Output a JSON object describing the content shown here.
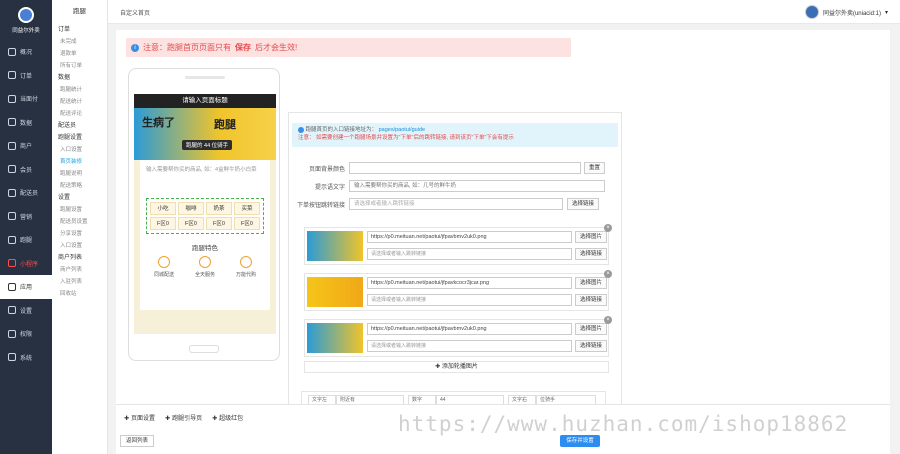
{
  "app": {
    "name": "同益尔外卖"
  },
  "sidebar": {
    "items": [
      {
        "label": "概况",
        "icon": "dashboard-icon",
        "state": ""
      },
      {
        "label": "订单",
        "icon": "order-icon",
        "state": ""
      },
      {
        "label": "当面付",
        "icon": "pay-icon",
        "state": ""
      },
      {
        "label": "数据",
        "icon": "data-icon",
        "state": ""
      },
      {
        "label": "商户",
        "icon": "store-icon",
        "state": ""
      },
      {
        "label": "会员",
        "icon": "member-icon",
        "state": ""
      },
      {
        "label": "配送员",
        "icon": "rider-icon",
        "state": ""
      },
      {
        "label": "营销",
        "icon": "marketing-icon",
        "state": ""
      },
      {
        "label": "跑腿",
        "icon": "errand-icon",
        "state": ""
      },
      {
        "label": "小程序",
        "icon": "miniapp-icon",
        "state": "red"
      },
      {
        "label": "应用",
        "icon": "apps-icon",
        "state": "active"
      },
      {
        "label": "设置",
        "icon": "settings-icon",
        "state": ""
      },
      {
        "label": "权限",
        "icon": "permission-icon",
        "state": ""
      },
      {
        "label": "系统",
        "icon": "system-icon",
        "state": ""
      }
    ]
  },
  "subnav": {
    "head": "跑腿",
    "groups": [
      {
        "label": "订单",
        "links": [
          "未完成",
          "退款单",
          "所有订单"
        ]
      },
      {
        "label": "数据",
        "links": [
          "跑腿统计",
          "配送统计",
          "配送评论"
        ]
      },
      {
        "label": "配送员",
        "links": []
      },
      {
        "label": "跑腿设置",
        "links": [
          "入口设置",
          "首页装修",
          "跑腿说明",
          "配送策略"
        ]
      },
      {
        "label": "设置",
        "links": [
          "跑腿设置",
          "配送员设置",
          "分享设置",
          "入口设置"
        ]
      },
      {
        "label": "商户列表",
        "links": [
          "商户列表",
          "入驻列表",
          "回收站"
        ]
      }
    ],
    "active": "首页装修"
  },
  "topbar": {
    "breadcrumb": "自定义首页",
    "user": "同益尔外卖(uniacid:1)",
    "caret": "▾"
  },
  "alert": {
    "text_pre": "注意：跑腿首页页面只有",
    "text_em": "保存",
    "text_post": "后才会生效!",
    "icon": "i"
  },
  "phone": {
    "title": "请输入页面标题",
    "banner_text1": "生病了",
    "banner_text2": "跑腿",
    "banner_pill": "跑腿的 44 位骑手",
    "textarea": "输入需要帮你买的商品, 如：4盒鲜牛奶小白菜",
    "grid": [
      "小吃",
      "咖啡",
      "奶茶",
      "买菜",
      "F区0",
      "F区0",
      "F区0",
      "F区0"
    ],
    "grid_title": "跑腿特色",
    "features": [
      "同城配送",
      "全天服务",
      "万能代购"
    ]
  },
  "config": {
    "info_pre": "跑腿首页的入口链接地址为：",
    "info_link": "pages/paotui/guide",
    "info_line2_pre": "注意：",
    "info_line2": "如需要创建一个跑腿场景并设置为\"下单\"后的跳转链接, 请到该页\"下单\"下会有提示",
    "bg_label": "页面背景颜色",
    "bg_reset": "重置",
    "tip_label": "提示语文字",
    "tip_value": "输入需要帮你买的商品, 如：几号的鲜牛奶",
    "link_label": "下单按钮跳转链接",
    "link_placeholder": "请选择或者输入跳转链接",
    "link_btn": "选择链接",
    "images": [
      {
        "url": "https://p0.meituan.net/paotui/jfpavbmv2uk0.png",
        "placeholder": "请选择或者输入跳转链接",
        "btn1": "选择图片",
        "btn2": "选择链接"
      },
      {
        "url": "https://p0.meituan.net/paotui/jfpavkcocr3jcar.png",
        "placeholder": "请选择或者输入跳转链接",
        "btn1": "选择图片",
        "btn2": "选择链接"
      },
      {
        "url": "https://p0.meituan.net/paotui/jfpavbmv2uk0.png",
        "placeholder": "请选择或者输入跳转链接",
        "btn1": "选择图片",
        "btn2": "选择链接"
      }
    ],
    "add_image": "添加轮播图片",
    "nav_row": {
      "c1": "文字左",
      "c2": "附近有",
      "c3": "数字",
      "c4": "44",
      "c5": "文字右",
      "c6": "位骑手"
    },
    "close": "×"
  },
  "bottom": {
    "tabs": [
      "页面设置",
      "跑腿引导页",
      "超级红包"
    ],
    "back": "返回列表",
    "save": "保存并设置"
  },
  "watermark": "https://www.huzhan.com/ishop18862"
}
